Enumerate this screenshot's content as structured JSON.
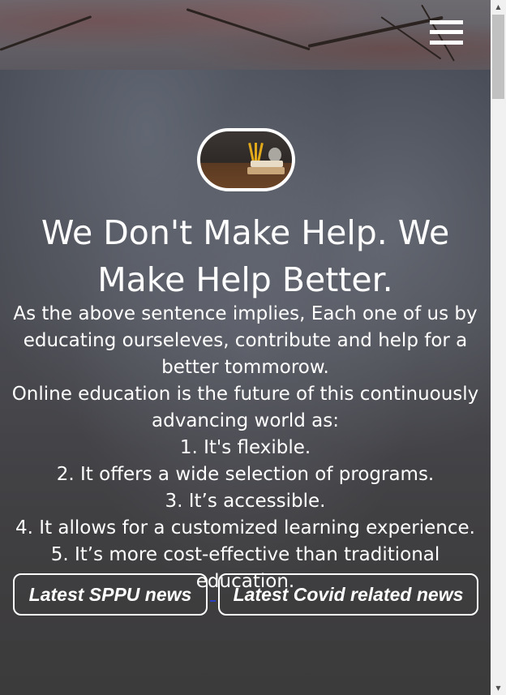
{
  "header": {
    "menu_icon": "hamburger-menu-icon"
  },
  "hero": {
    "logo_icon": "books-logo-icon",
    "headline": "We Don't Make Help. We Make Help Better.",
    "paragraphs": [
      "As the above sentence implies, Each one of us by educating ourseleves, contribute and help for a better tommorow.",
      "Online education is the future of this continuously advancing world as:",
      "1. It's flexible.",
      "2. It offers a wide selection of programs.",
      "3. It’s accessible.",
      "4. It allows for a customized learning experience.",
      "5. It’s more cost-effective than traditional education."
    ]
  },
  "buttons": {
    "sppu_news": "Latest SPPU news",
    "covid_news": "Latest Covid related news"
  },
  "colors": {
    "text": "#ffffff",
    "link": "#2a3fc7"
  }
}
